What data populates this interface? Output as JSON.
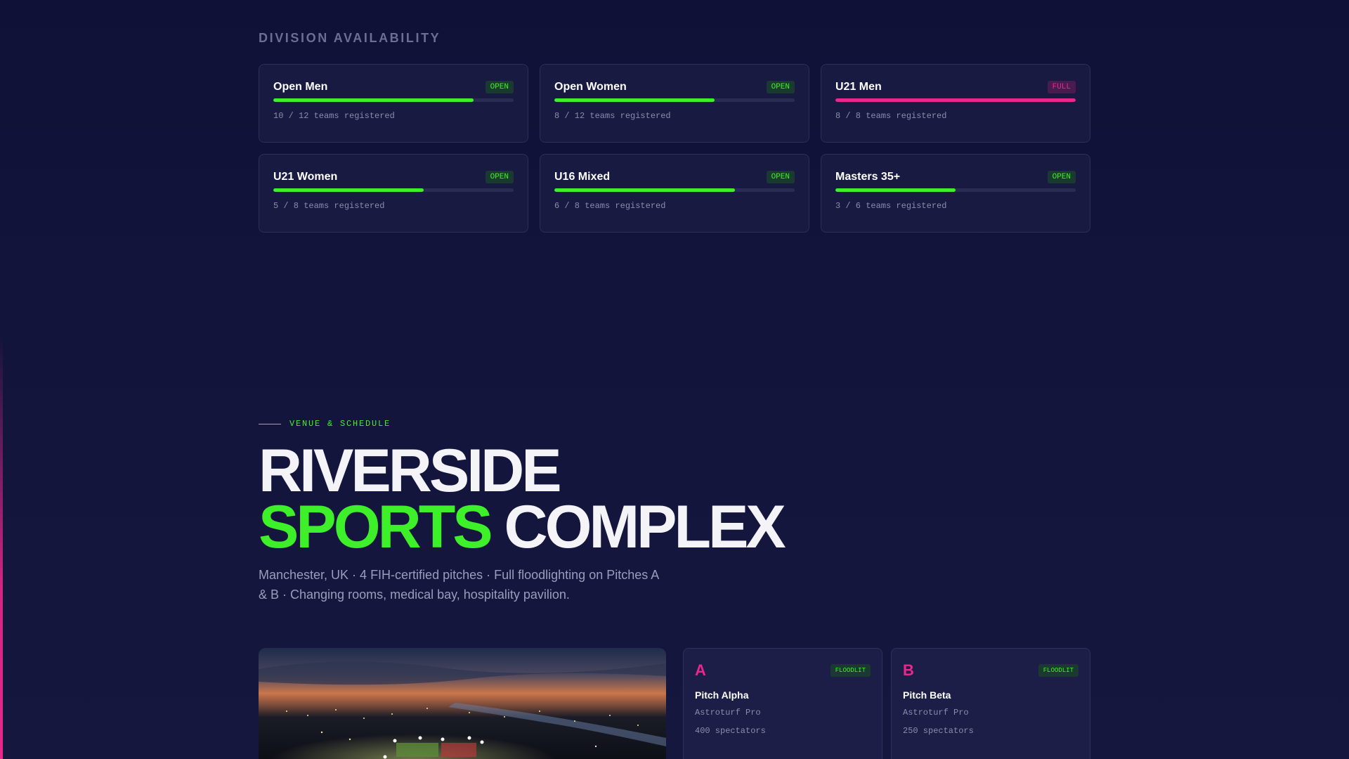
{
  "divisions": {
    "section_title": "DIVISION AVAILABILITY",
    "items": [
      {
        "name": "Open Men",
        "status": "OPEN",
        "count_text": "10 / 12 teams registered",
        "fill": 0.833
      },
      {
        "name": "Open Women",
        "status": "OPEN",
        "count_text": "8 / 12 teams registered",
        "fill": 0.667
      },
      {
        "name": "U21 Men",
        "status": "FULL",
        "count_text": "8 / 8 teams registered",
        "fill": 1.0
      },
      {
        "name": "U21 Women",
        "status": "OPEN",
        "count_text": "5 / 8 teams registered",
        "fill": 0.625
      },
      {
        "name": "U16 Mixed",
        "status": "OPEN",
        "count_text": "6 / 8 teams registered",
        "fill": 0.75
      },
      {
        "name": "Masters 35+",
        "status": "OPEN",
        "count_text": "3 / 6 teams registered",
        "fill": 0.5
      }
    ]
  },
  "venue": {
    "eyebrow": "VENUE & SCHEDULE",
    "title_line1": "RIVERSIDE",
    "title_green": "SPORTS",
    "title_rest": "COMPLEX",
    "description": "Manchester, UK · 4 FIH-certified pitches · Full floodlighting on Pitches A & B · Changing rooms, medical bay, hospitality pavilion.",
    "pitches": [
      {
        "letter": "A",
        "badge": "FLOODLIT",
        "name": "Pitch Alpha",
        "surface": "Astroturf Pro",
        "capacity": "400 spectators"
      },
      {
        "letter": "B",
        "badge": "FLOODLIT",
        "name": "Pitch Beta",
        "surface": "Astroturf Pro",
        "capacity": "250 spectators"
      }
    ]
  },
  "colors": {
    "accent_green": "#3df02a",
    "accent_pink": "#e8288c",
    "background": "#11133a"
  }
}
